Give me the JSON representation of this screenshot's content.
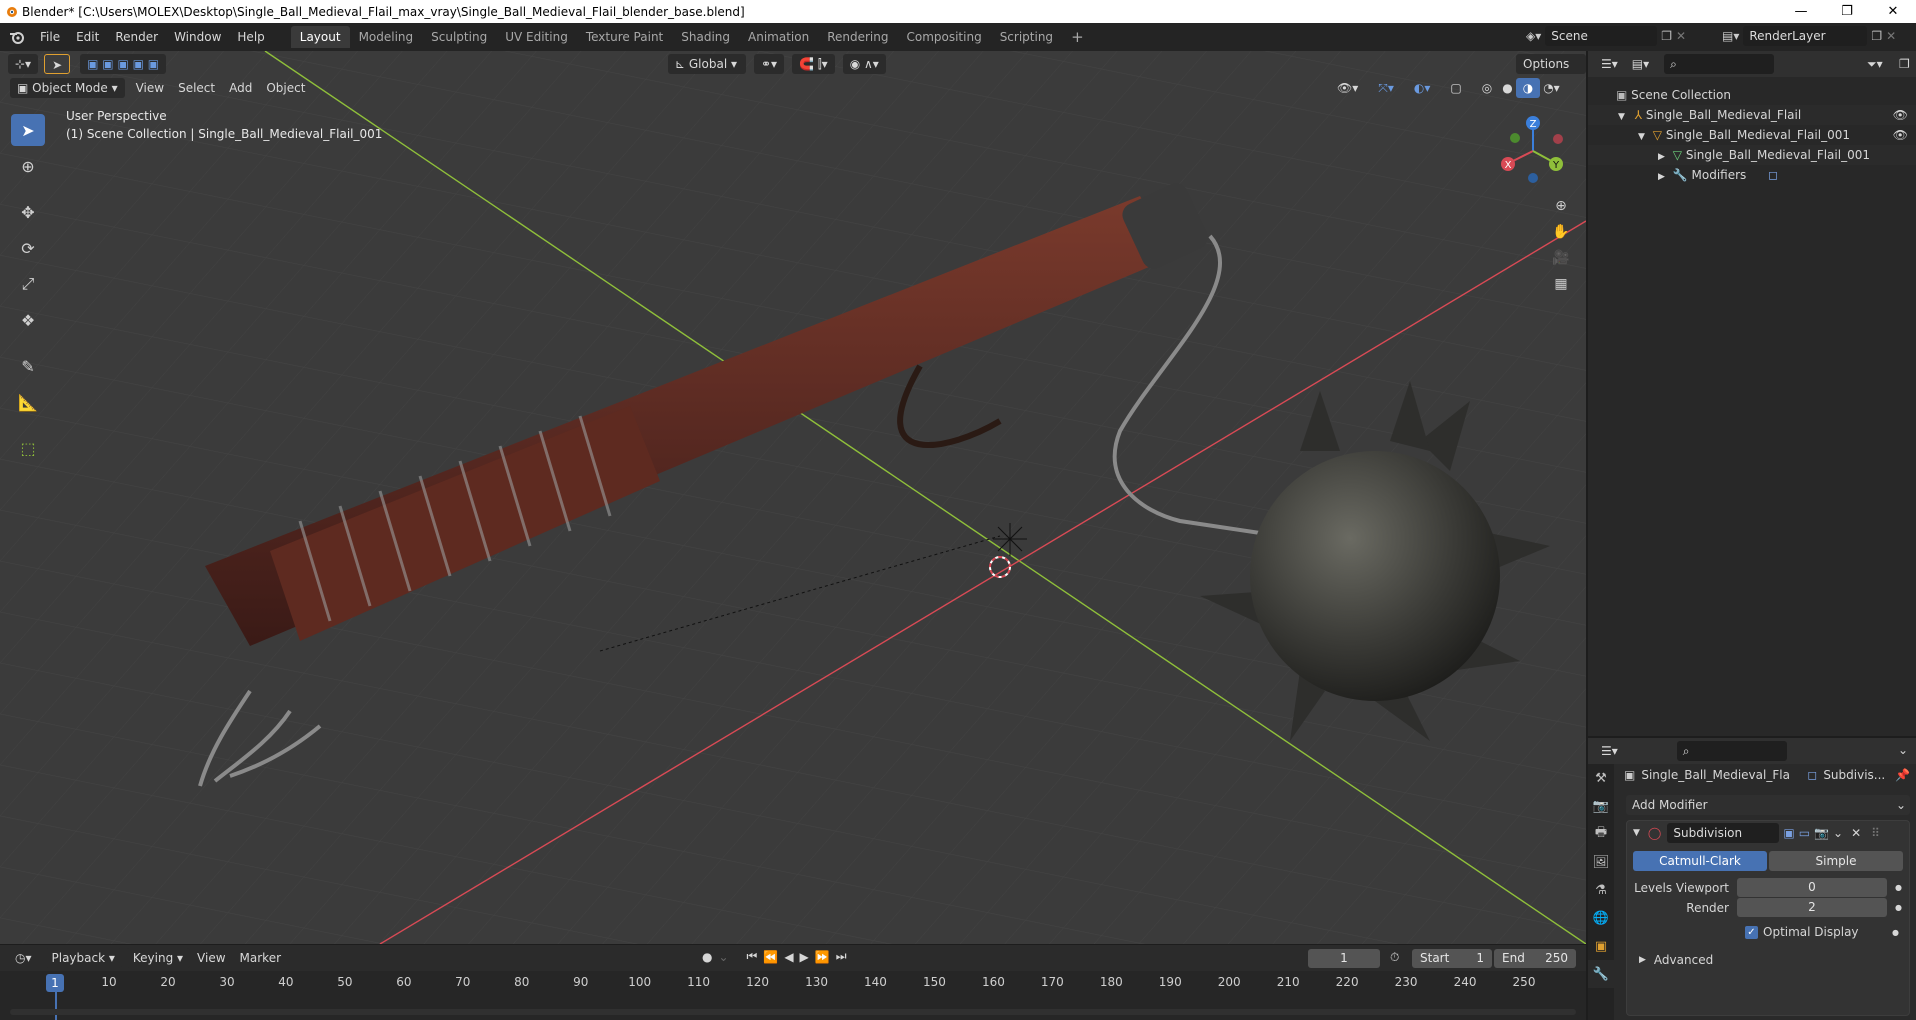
{
  "window": {
    "title": "Blender* [C:\\Users\\MOLEX\\Desktop\\Single_Ball_Medieval_Flail_max_vray\\Single_Ball_Medieval_Flail_blender_base.blend]"
  },
  "menu": [
    "File",
    "Edit",
    "Render",
    "Window",
    "Help"
  ],
  "workspaces": [
    "Layout",
    "Modeling",
    "Sculpting",
    "UV Editing",
    "Texture Paint",
    "Shading",
    "Animation",
    "Rendering",
    "Compositing",
    "Scripting"
  ],
  "active_workspace": "Layout",
  "scene": {
    "label": "Scene",
    "render_layer": "RenderLayer"
  },
  "viewport": {
    "mode": "Object Mode",
    "header_menus": [
      "View",
      "Select",
      "Add",
      "Object"
    ],
    "orientation": "Global",
    "options_label": "Options",
    "overlay_line1": "User Perspective",
    "overlay_line2": "(1) Scene Collection | Single_Ball_Medieval_Flail_001",
    "gizmo_axes": [
      "X",
      "Y",
      "Z"
    ]
  },
  "outliner": {
    "root": "Scene Collection",
    "items": [
      {
        "label": "Single_Ball_Medieval_Flail",
        "icon": "empty-icon"
      },
      {
        "label": "Single_Ball_Medieval_Flail_001",
        "icon": "mesh-object-icon"
      },
      {
        "label": "Single_Ball_Medieval_Flail_001",
        "icon": "mesh-data-icon"
      },
      {
        "label": "Modifiers",
        "icon": "wrench-icon"
      }
    ]
  },
  "properties": {
    "object_name": "Single_Ball_Medieval_Fla...",
    "modifier_tab": "Subdivis...",
    "add_modifier": "Add Modifier",
    "modifier_name": "Subdivision",
    "type_options": [
      "Catmull-Clark",
      "Simple"
    ],
    "active_type": "Catmull-Clark",
    "levels_viewport_label": "Levels Viewport",
    "levels_viewport_value": "0",
    "render_label": "Render",
    "render_value": "2",
    "optimal_display_label": "Optimal Display",
    "optimal_display_checked": true,
    "advanced_label": "Advanced"
  },
  "timeline": {
    "menus": [
      "Playback",
      "Keying",
      "View",
      "Marker"
    ],
    "current_frame": "1",
    "start_label": "Start",
    "start_value": "1",
    "end_label": "End",
    "end_value": "250",
    "ticks": [
      "1",
      "10",
      "20",
      "30",
      "40",
      "50",
      "60",
      "70",
      "80",
      "90",
      "100",
      "110",
      "120",
      "130",
      "140",
      "150",
      "160",
      "170",
      "180",
      "190",
      "200",
      "210",
      "220",
      "230",
      "240",
      "250"
    ]
  },
  "colors": {
    "accent": "#4772b3",
    "x_axis": "#d84a55",
    "y_axis": "#8fbf3a",
    "z_axis": "#3b7fdb"
  }
}
